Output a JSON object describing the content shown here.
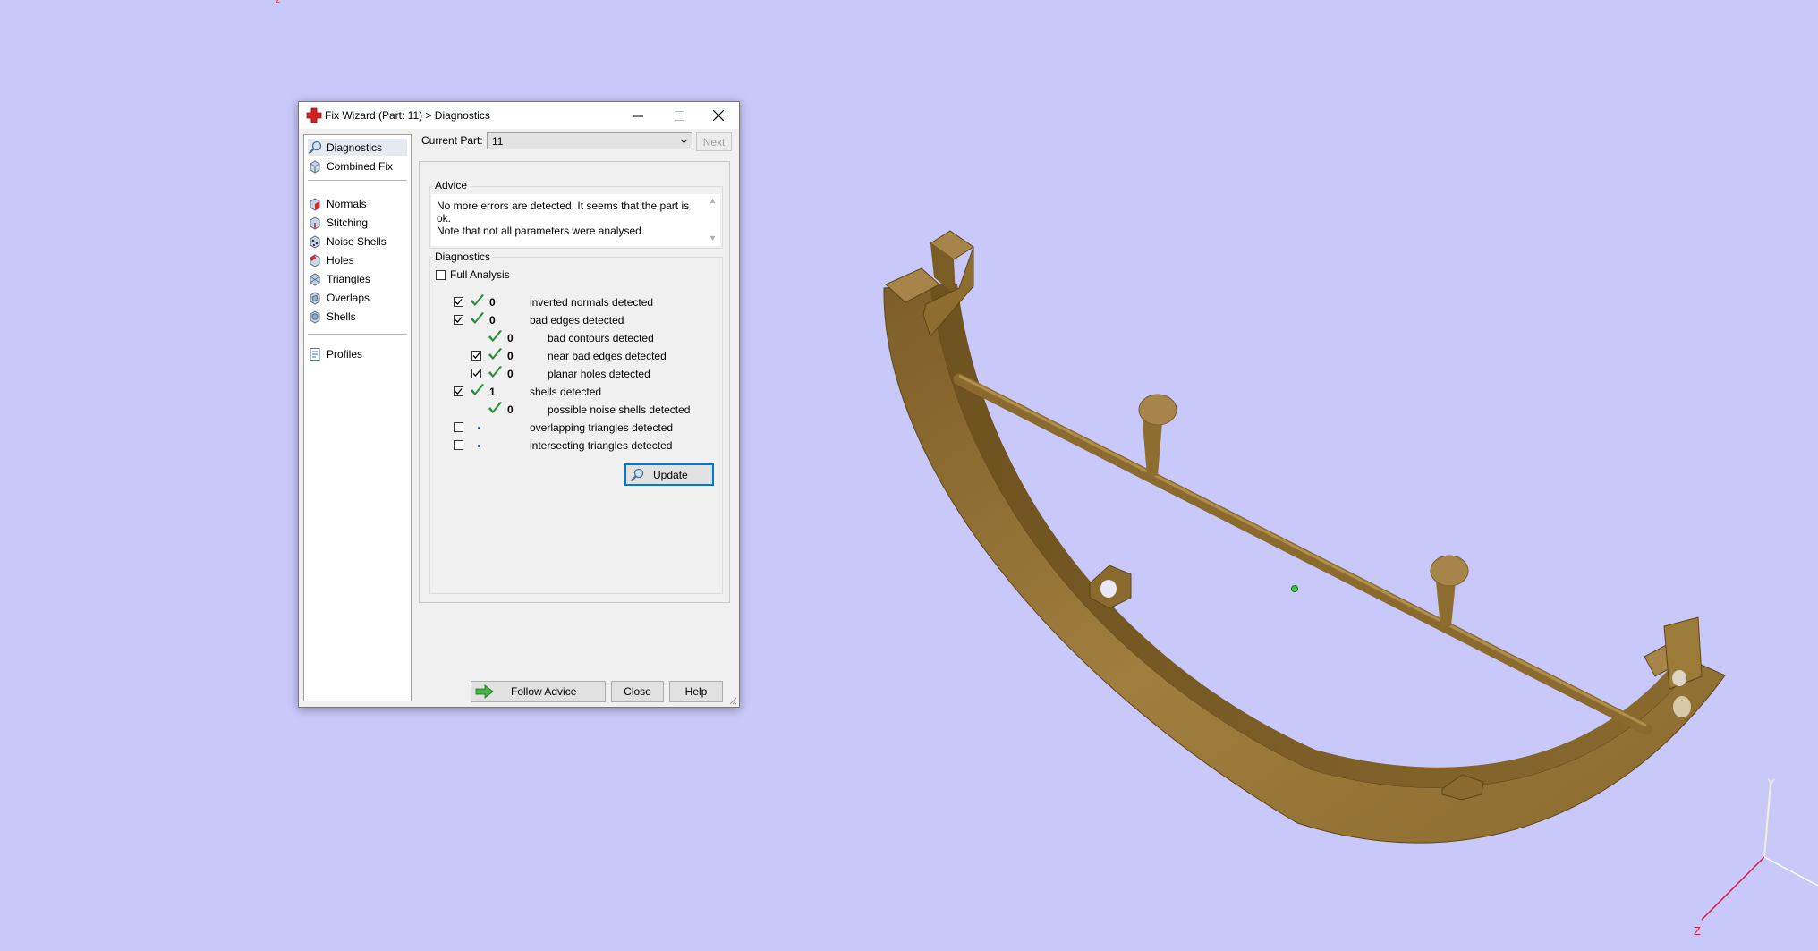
{
  "dialog": {
    "title": "Fix Wizard (Part: 11) > Diagnostics",
    "sidebar": {
      "items": [
        {
          "label": "Diagnostics",
          "icon": "magnifier-icon"
        },
        {
          "label": "Combined Fix",
          "icon": "cube-icon"
        },
        {
          "label": "Normals",
          "icon": "normals-icon"
        },
        {
          "label": "Stitching",
          "icon": "stitching-icon"
        },
        {
          "label": "Noise Shells",
          "icon": "noise-shells-icon"
        },
        {
          "label": "Holes",
          "icon": "holes-icon"
        },
        {
          "label": "Triangles",
          "icon": "triangles-icon"
        },
        {
          "label": "Overlaps",
          "icon": "overlaps-icon"
        },
        {
          "label": "Shells",
          "icon": "shells-icon"
        },
        {
          "label": "Profiles",
          "icon": "profiles-icon"
        }
      ]
    },
    "current_part_label": "Current Part:",
    "current_part_value": "11",
    "next_label": "Next",
    "advice": {
      "title": "Advice",
      "line1": "No more errors are detected. It seems that the part is ok.",
      "line2": "Note that not all parameters were analysed."
    },
    "diagnostics": {
      "title": "Diagnostics",
      "full_analysis_label": "Full Analysis",
      "rows": [
        {
          "count": "0",
          "label": "inverted normals detected"
        },
        {
          "count": "0",
          "label": "bad edges detected"
        },
        {
          "count": "0",
          "label": "bad contours detected"
        },
        {
          "count": "0",
          "label": "near bad edges detected"
        },
        {
          "count": "0",
          "label": "planar holes detected"
        },
        {
          "count": "1",
          "label": "shells detected"
        },
        {
          "count": "0",
          "label": "possible noise shells detected"
        },
        {
          "count": "",
          "label": "overlapping triangles detected"
        },
        {
          "count": "",
          "label": "intersecting triangles detected"
        }
      ],
      "update_label": "Update"
    },
    "buttons": {
      "follow_advice": "Follow Advice",
      "close": "Close",
      "help": "Help"
    }
  },
  "axes": {
    "y_label": "Y",
    "z_label": "Z"
  },
  "colors": {
    "background": "#c8c8fa",
    "part": "#9c7a38",
    "check": "#2e8b3e",
    "accent": "#0078d7"
  }
}
